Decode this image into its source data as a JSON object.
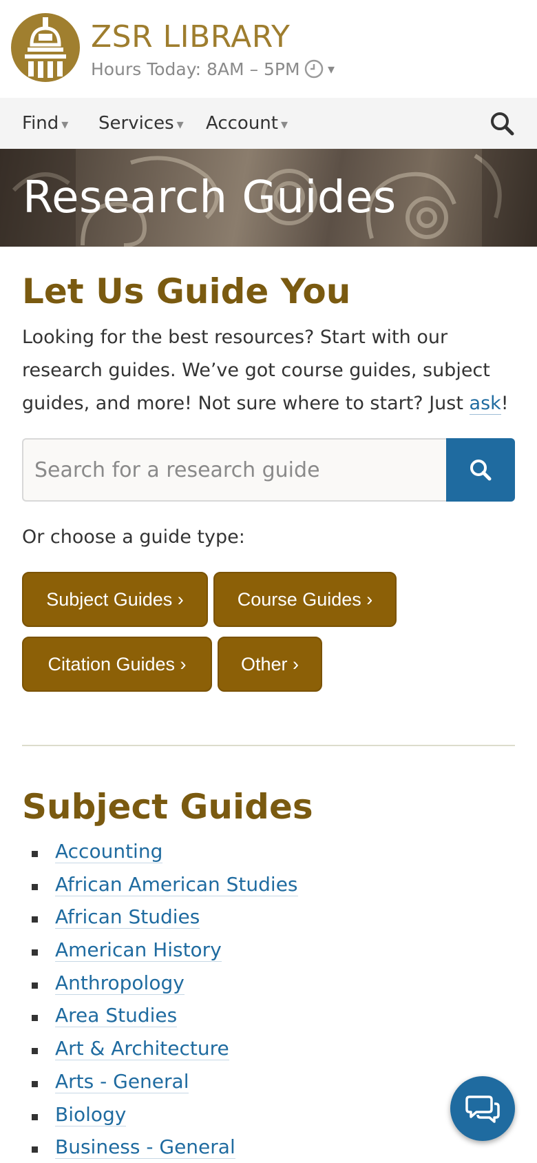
{
  "header": {
    "brand": "ZSR LIBRARY",
    "hours": "Hours Today: 8AM – 5PM",
    "caret": "▾"
  },
  "nav": {
    "items": [
      {
        "label": "Find"
      },
      {
        "label": "Services"
      },
      {
        "label": "Account"
      }
    ],
    "caret": "▾"
  },
  "banner": {
    "title": "Research Guides"
  },
  "intro": {
    "heading": "Let Us Guide You",
    "text": "Looking for the best resources? Start with our research guides. We’ve got course guides, subject guides, and more! Not sure where to start? Just ",
    "link": "ask",
    "suffix": "!"
  },
  "search": {
    "placeholder": "Search for a research guide",
    "value": ""
  },
  "guide_types": {
    "label": "Or choose a guide type:",
    "buttons": [
      {
        "label": "Subject Guides ›"
      },
      {
        "label": "Course Guides ›"
      },
      {
        "label": "Citation Guides ›"
      },
      {
        "label": "Other ›"
      }
    ]
  },
  "subject_guides": {
    "heading": "Subject Guides",
    "items": [
      "Accounting",
      "African American Studies",
      "African Studies",
      "American History",
      "Anthropology",
      "Area Studies",
      "Art & Architecture",
      "Arts - General",
      "Biology",
      "Business - General"
    ]
  },
  "colors": {
    "brand_gold": "#9e7d2e",
    "heading_brown": "#7a5a10",
    "button_gold": "#8c6007",
    "link_blue": "#1f6ba0"
  },
  "icons": {
    "logo": "library-building-logo",
    "clock": "clock-icon",
    "search": "search-icon",
    "chat": "chat-icon"
  }
}
